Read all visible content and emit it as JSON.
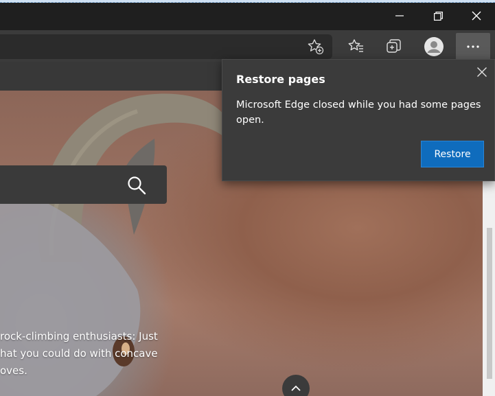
{
  "window": {
    "minimize_icon": "minimize-icon",
    "maximize_icon": "restore-window-icon",
    "close_icon": "close-icon"
  },
  "toolbar": {
    "add_favorite_icon": "star-add-icon",
    "favorites_icon": "favorites-list-icon",
    "collections_icon": "collections-icon",
    "profile_icon": "profile-avatar-icon",
    "more_icon": "more-dots-icon"
  },
  "page": {
    "search_icon": "search-icon",
    "caption": "rock-climbing enthusiasts: Just\nhat you could do with concave\noves.",
    "scroll_up_icon": "chevron-up-icon"
  },
  "flyout": {
    "title": "Restore pages",
    "body": "Microsoft Edge closed while you had some pages open.",
    "restore_label": "Restore",
    "close_icon": "close-icon"
  },
  "colors": {
    "accent": "#0f6cbd",
    "flyout_bg": "#3b3b3b",
    "titlebar_bg": "#1f1f1f"
  }
}
